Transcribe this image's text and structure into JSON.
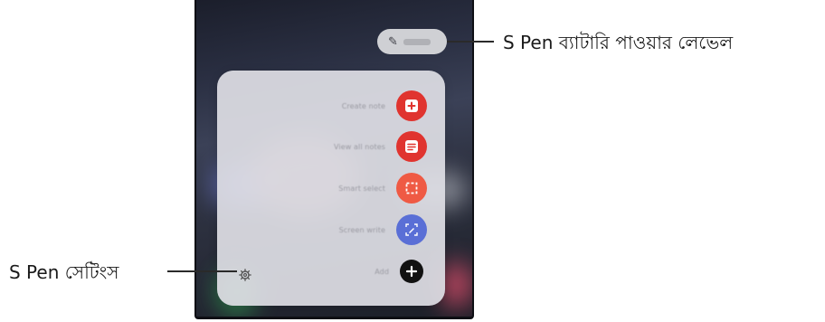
{
  "callouts": {
    "battery_label": "S Pen ব্যাটারি পাওয়ার লেভেল",
    "settings_label": "S Pen সেটিংস"
  },
  "air_command": {
    "items": [
      {
        "label": "Create note",
        "icon": "note-add-icon",
        "color": "#e0342f"
      },
      {
        "label": "View all notes",
        "icon": "notes-list-icon",
        "color": "#e0342f"
      },
      {
        "label": "Smart select",
        "icon": "smart-select-icon",
        "color": "#ef5a44"
      },
      {
        "label": "Screen write",
        "icon": "screen-write-icon",
        "color": "#5a6fd6"
      },
      {
        "label": "Add",
        "icon": "plus-icon",
        "color": "#111111"
      }
    ],
    "settings_icon": "gear-icon"
  },
  "battery": {
    "icon": "pen-icon"
  }
}
